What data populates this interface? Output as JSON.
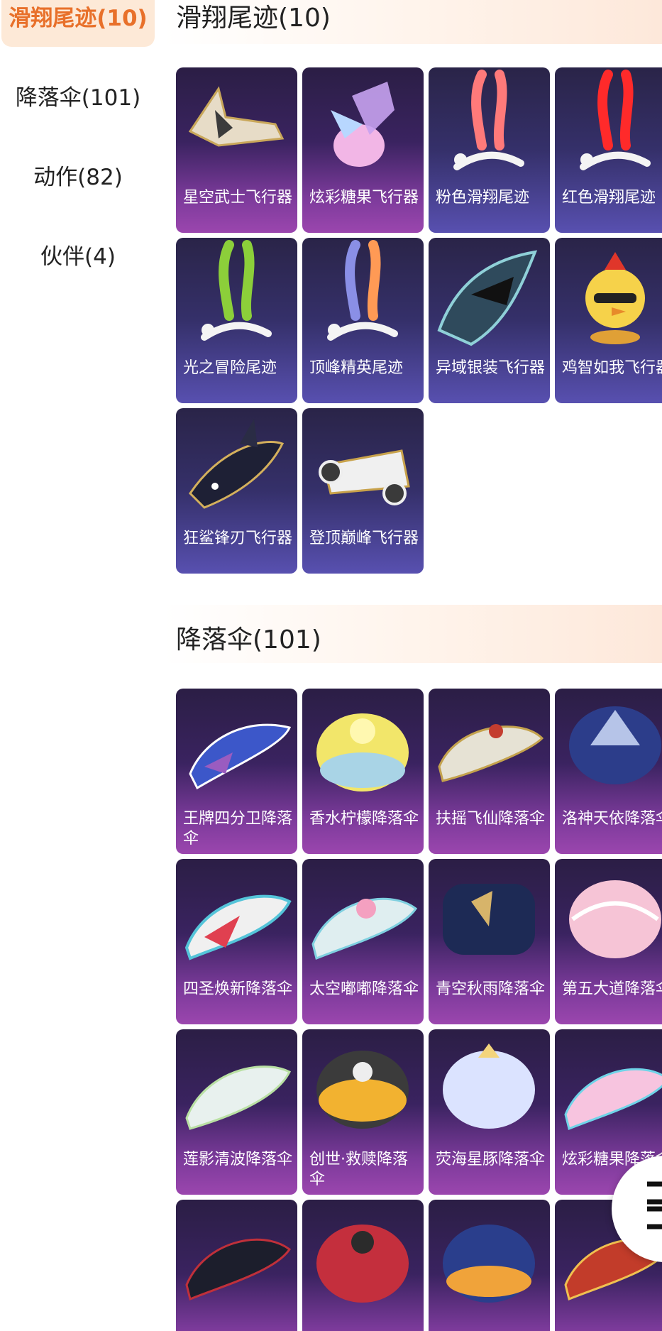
{
  "sidebar": {
    "items": [
      {
        "label": "滑翔尾迹(10)"
      },
      {
        "label": "降落伞(101)"
      },
      {
        "label": "动作(82)"
      },
      {
        "label": "伙伴(4)"
      }
    ]
  },
  "sections": [
    {
      "title": "滑翔尾迹(10)",
      "items": [
        {
          "name": "星空武士飞行器",
          "icon": "glider-icon"
        },
        {
          "name": "炫彩糖果飞行器",
          "icon": "candy-glider-icon"
        },
        {
          "name": "粉色滑翔尾迹",
          "icon": "pink-trail-icon"
        },
        {
          "name": "红色滑翔尾迹",
          "icon": "red-trail-icon"
        },
        {
          "name": "光之冒险尾迹",
          "icon": "green-trail-icon"
        },
        {
          "name": "顶峰精英尾迹",
          "icon": "orange-trail-icon"
        },
        {
          "name": "异域银装飞行器",
          "icon": "winged-glider-icon"
        },
        {
          "name": "鸡智如我飞行器",
          "icon": "chicken-glider-icon"
        },
        {
          "name": "狂鲨锋刃飞行器",
          "icon": "shark-glider-icon"
        },
        {
          "name": "登顶巅峰飞行器",
          "icon": "jet-glider-icon"
        }
      ]
    },
    {
      "title": "降落伞(101)",
      "items": [
        {
          "name": "王牌四分卫降落伞",
          "icon": "parachute-icon"
        },
        {
          "name": "香水柠檬降落伞",
          "icon": "parachute-icon"
        },
        {
          "name": "扶摇飞仙降落伞",
          "icon": "parachute-icon"
        },
        {
          "name": "洛神天依降落伞",
          "icon": "parachute-icon"
        },
        {
          "name": "四圣焕新降落伞",
          "icon": "parachute-icon"
        },
        {
          "name": "太空嘟嘟降落伞",
          "icon": "parachute-icon"
        },
        {
          "name": "青空秋雨降落伞",
          "icon": "parachute-icon"
        },
        {
          "name": "第五大道降落伞",
          "icon": "parachute-icon"
        },
        {
          "name": "莲影清波降落伞",
          "icon": "parachute-icon"
        },
        {
          "name": "创世·救赎降落伞",
          "icon": "parachute-icon"
        },
        {
          "name": "荧海星豚降落伞",
          "icon": "parachute-icon"
        },
        {
          "name": "炫彩糖果降落伞",
          "icon": "parachute-icon"
        },
        {
          "name": "",
          "icon": "parachute-icon"
        },
        {
          "name": "",
          "icon": "parachute-icon"
        },
        {
          "name": "",
          "icon": "parachute-icon"
        },
        {
          "name": "",
          "icon": "parachute-icon"
        }
      ]
    }
  ],
  "colors": {
    "accent": "#e8702a",
    "active_bg": "#fde9d7",
    "card_top": "#2b1e45",
    "card_bottom": "#9b46ae"
  }
}
